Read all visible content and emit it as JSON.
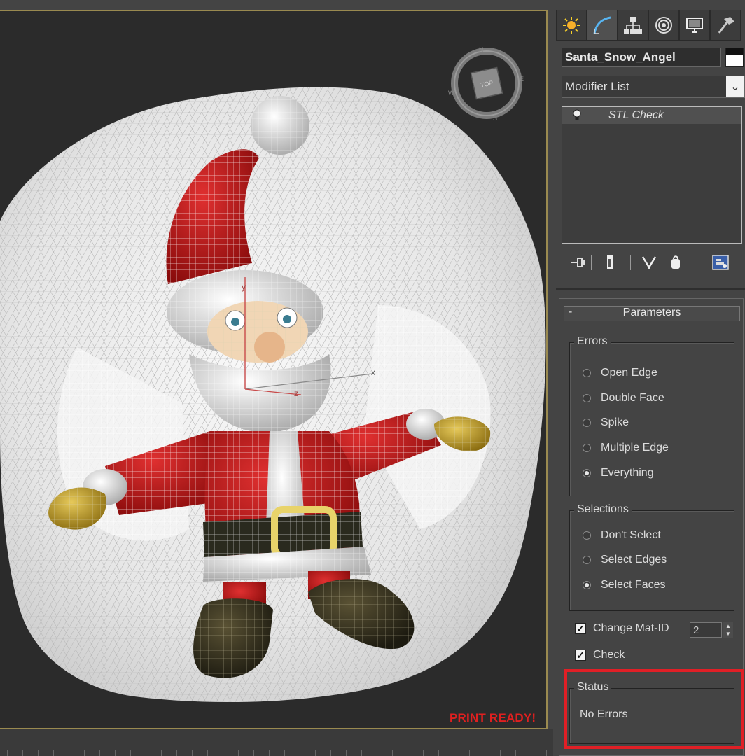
{
  "viewport": {
    "overlay_text": "PRINT READY!",
    "overlay_color": "#e02020",
    "viewcube": {
      "face_label": "TOP",
      "compass": [
        "N",
        "E",
        "S",
        "W"
      ]
    },
    "axis_labels": [
      "y",
      "x",
      "z"
    ]
  },
  "command_panel": {
    "tabs": [
      {
        "icon": "sun-icon",
        "name": "Create"
      },
      {
        "icon": "curve-icon",
        "name": "Modify"
      },
      {
        "icon": "hierarchy-icon",
        "name": "Hierarchy"
      },
      {
        "icon": "motion-icon",
        "name": "Motion"
      },
      {
        "icon": "display-icon",
        "name": "Display"
      },
      {
        "icon": "hammer-icon",
        "name": "Utilities"
      }
    ],
    "object_name": "Santa_Snow_Angel",
    "modifier_list_label": "Modifier List",
    "modifier_stack": [
      "STL Check"
    ],
    "stack_tools": [
      "pin-stack-icon",
      "show-end-result-icon",
      "make-unique-icon",
      "remove-modifier-icon",
      "configure-sets-icon"
    ]
  },
  "parameters": {
    "title": "Parameters",
    "toggle": "-",
    "errors": {
      "title": "Errors",
      "options": [
        "Open Edge",
        "Double Face",
        "Spike",
        "Multiple Edge",
        "Everything"
      ],
      "selected": "Everything"
    },
    "selections": {
      "title": "Selections",
      "options": [
        "Don't Select",
        "Select Edges",
        "Select Faces"
      ],
      "selected": "Select Faces"
    },
    "change_mat_id": {
      "label": "Change Mat-ID",
      "checked": true,
      "value": "2"
    },
    "check": {
      "label": "Check",
      "checked": true
    },
    "status": {
      "title": "Status",
      "text": "No Errors"
    },
    "highlight_color": "#e01f26"
  }
}
